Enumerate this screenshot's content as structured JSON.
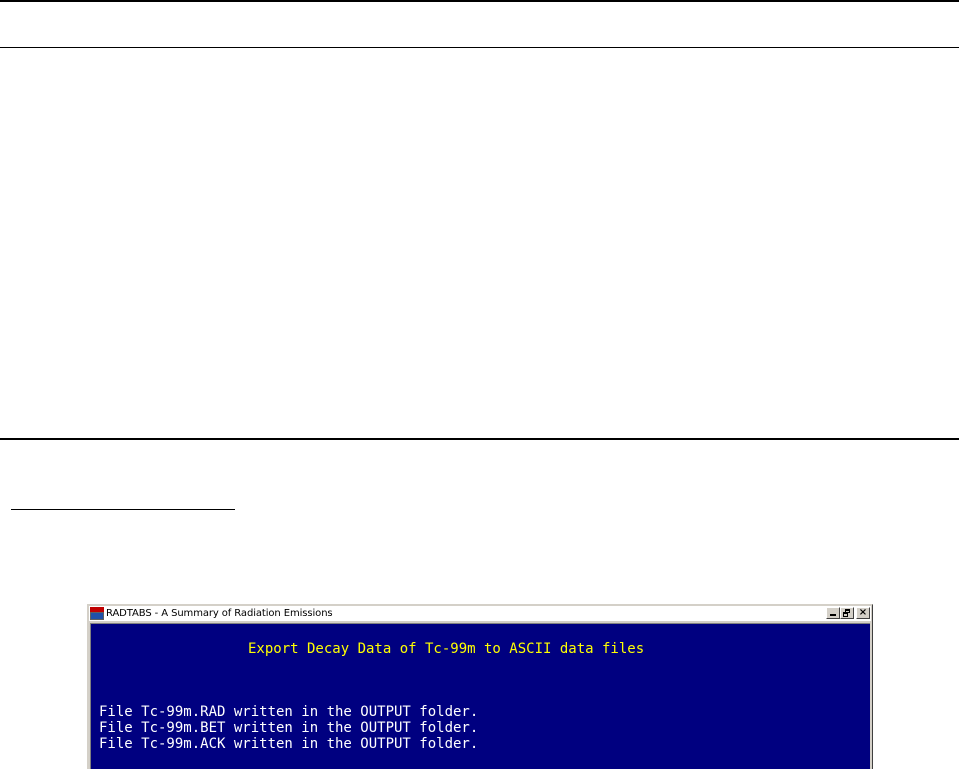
{
  "window": {
    "title": "RADTABS - A Summary of Radiation Emissions",
    "buttons": {
      "minimize": "minimize",
      "restore": "restore",
      "close": "×"
    }
  },
  "console": {
    "heading": "Export Decay Data of Tc-99m to ASCII data files",
    "lines": [
      "File Tc-99m.RAD written in the OUTPUT folder.",
      "File Tc-99m.BET written in the OUTPUT folder.",
      "File Tc-99m.ACK written in the OUTPUT folder."
    ]
  },
  "colors": {
    "console_bg": "#000080",
    "heading_text": "#ffff00",
    "console_text": "#ffffff",
    "titlebar_bg": "#ffffff",
    "window_frame": "#d4d0c8"
  },
  "icons": {
    "app": "radtabs-app-icon",
    "minimize": "minimize-icon",
    "restore": "restore-icon",
    "close": "close-icon"
  }
}
